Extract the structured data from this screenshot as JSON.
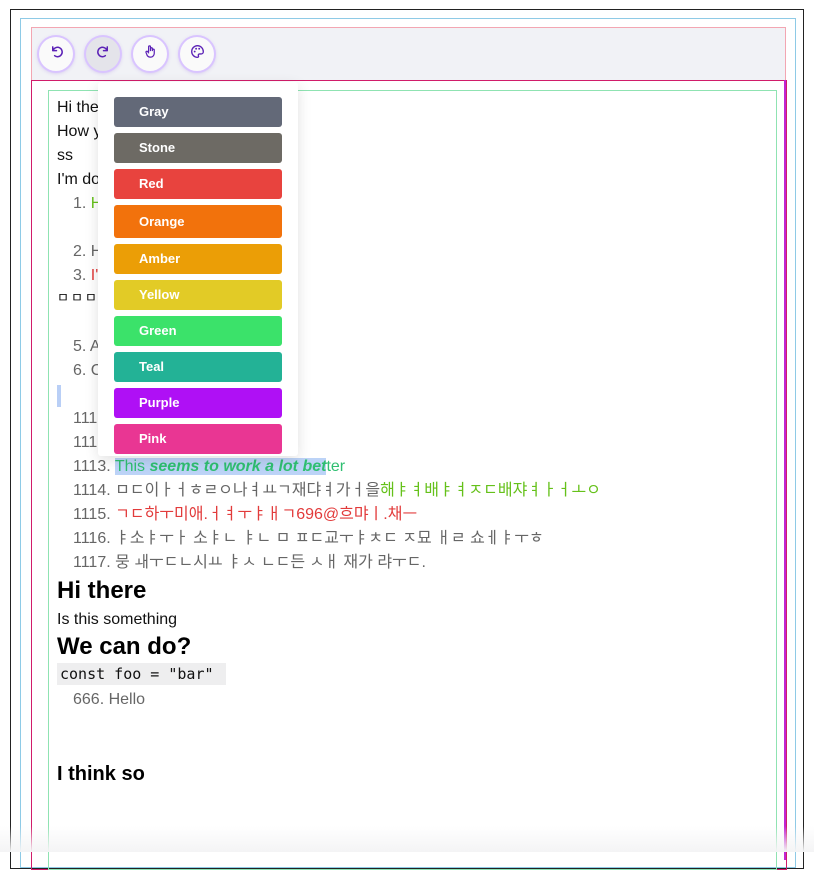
{
  "toolbar": {
    "buttons": [
      {
        "name": "undo-button",
        "icon": "undo-icon"
      },
      {
        "name": "redo-button",
        "icon": "redo-icon"
      },
      {
        "name": "hand-button",
        "icon": "hand-icon"
      },
      {
        "name": "palette-button",
        "icon": "palette-icon"
      }
    ],
    "icon_color": "#5b21b6"
  },
  "color_menu": {
    "options": [
      {
        "label": "Gray",
        "color": "#636978"
      },
      {
        "label": "Stone",
        "color": "#6d6a64"
      },
      {
        "label": "Red",
        "color": "#e8433e"
      },
      {
        "label": "Orange",
        "color": "#f2720c"
      },
      {
        "label": "Amber",
        "color": "#eb9e06"
      },
      {
        "label": "Yellow",
        "color": "#e2cb26"
      },
      {
        "label": "Green",
        "color": "#3be26a"
      },
      {
        "label": "Teal",
        "color": "#23b296"
      },
      {
        "label": "Purple",
        "color": "#af10f5"
      },
      {
        "label": "Pink",
        "color": "#e93693"
      }
    ]
  },
  "editor": {
    "lines": {
      "l1": "Hi the",
      "l2": "How y",
      "l3": "ss",
      "l4": "I'm do",
      "l5_num": "1.",
      "l5_text": "H",
      "l6_num": "2.",
      "l6_text": "H",
      "l7_num": "3.",
      "l7_text": "I'",
      "l8": "ㅁㅁㅁ",
      "l9_num": "5.",
      "l9_text": "A",
      "l10_num": "6.",
      "l10_text": "C",
      "l11": "111",
      "l12": "111",
      "l13_num": "1113.",
      "l13_a": "This ",
      "l13_b": "seems to work a lot bet",
      "l13_c": "ter",
      "l14_num": "1114.",
      "l14_a": "ㅁㄷ이ㅏㅓㅎㄹㅇ나ㅕㅛㄱ재댜ㅕ가ㅓ을",
      "l14_b": "해ㅑㅕ배ㅑㅕㅈㄷ배쟈ㅕㅏㅓㅗㅇ",
      "l15_num": "1115.",
      "l15_text": "ㄱㄷ하ㅜ미애.ㅓㅕㅜㅑㅐㄱ696@흐먀ㅣ.채ㅡ",
      "l16_num": "1116.",
      "l16_text": "ㅑ소ㅑㅜㅏ 소ㅑㄴ ㅑㄴ ㅁ ㅍㄷ교ㅜㅑㅊㄷ ㅈ묘 ㅐㄹ 쇼ㅔㅑㅜㅎ",
      "l17_num": "1117.",
      "l17_text": "뭉 ㅙㅜㄷㄴ시ㅛ ㅑㅅ ㄴㄷ든 ㅅㅐ 재가 랴ㅜㄷ.",
      "h_hi": "Hi there",
      "p_is": "Is this something",
      "h_we": "We can do?",
      "code": "const foo = \"bar\"",
      "l666_num": "666.",
      "l666_text": "Hello",
      "h_think": "I think so"
    }
  }
}
